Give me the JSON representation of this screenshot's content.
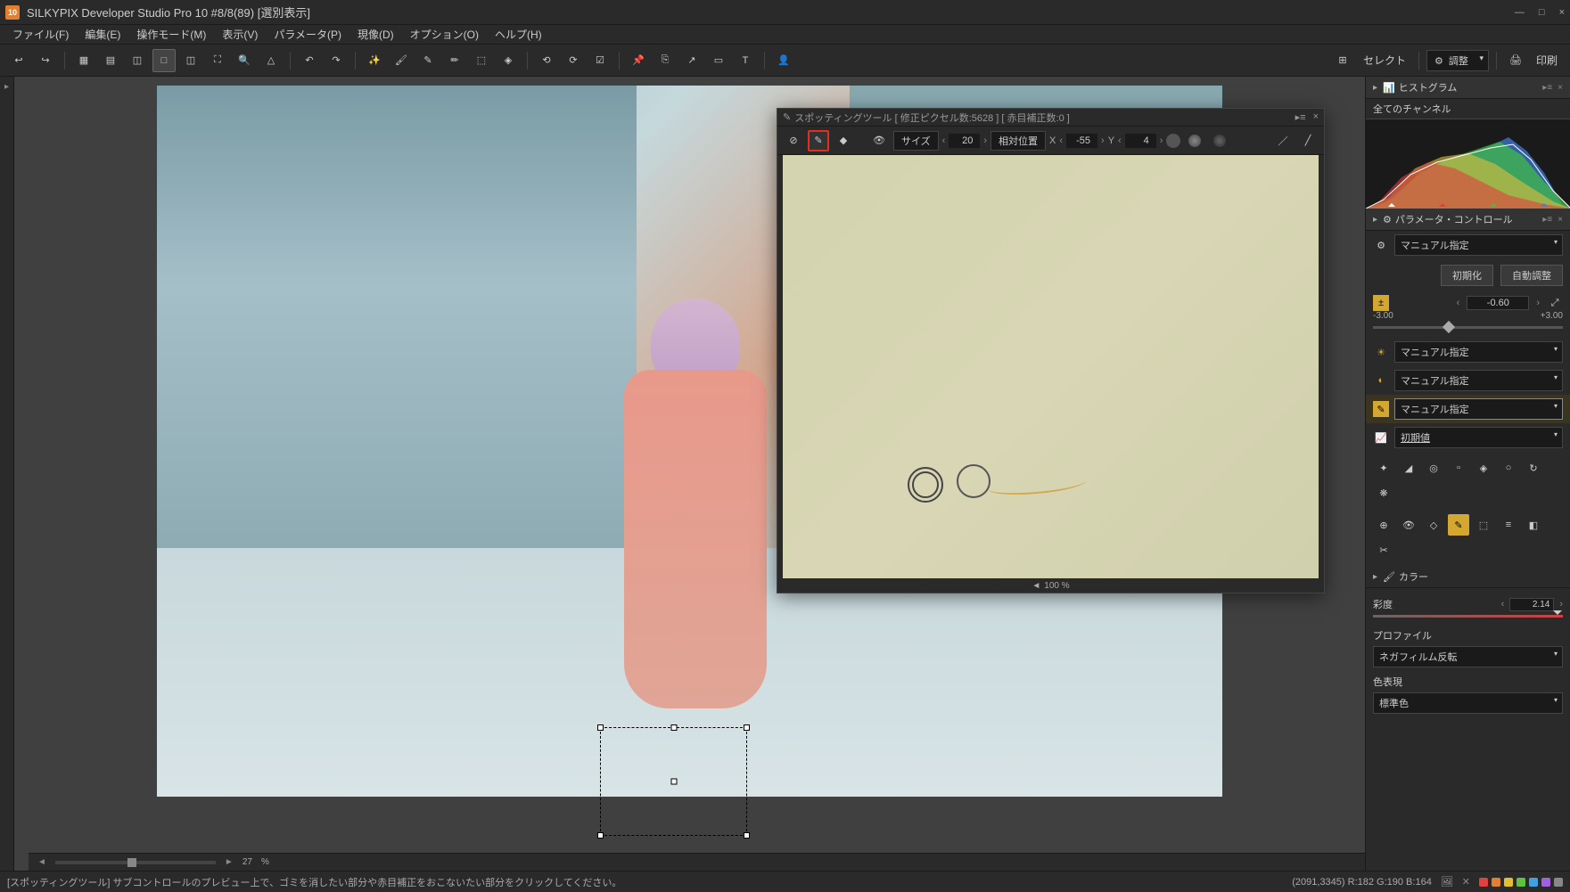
{
  "title": "SILKYPIX Developer Studio Pro 10    #8/8(89) [選別表示]",
  "menubar": [
    "ファイル(F)",
    "編集(E)",
    "操作モード(M)",
    "表示(V)",
    "パラメータ(P)",
    "現像(D)",
    "オプション(O)",
    "ヘルプ(H)"
  ],
  "toolbar_right": {
    "select": "セレクト",
    "adjust": "調整",
    "print": "印刷"
  },
  "canvas": {
    "zoom_percent": "27",
    "zoom_unit": "%"
  },
  "spotting": {
    "title": "スポッティングツール [ 修正ピクセル数:5628 ] [ 赤目補正数:0 ]",
    "size_label": "サイズ",
    "size_value": "20",
    "mode": "相対位置",
    "x_label": "X",
    "x_value": "-55",
    "y_label": "Y",
    "y_value": "4",
    "zoom": "100",
    "zoom_unit": "%"
  },
  "right": {
    "histogram_title": "ヒストグラム",
    "channel": "全てのチャンネル",
    "param_control_title": "パラメータ・コントロール",
    "mode_dd": "マニュアル指定",
    "init_btn": "初期化",
    "auto_btn": "自動調整",
    "exposure": {
      "value": "-0.60",
      "min": "-3.00",
      "max": "+3.00"
    },
    "rows": [
      {
        "label": "マニュアル指定"
      },
      {
        "label": "マニュアル指定"
      },
      {
        "label": "マニュアル指定"
      },
      {
        "label": "初期値",
        "underlined": true
      }
    ],
    "color_title": "カラー",
    "saturation_label": "彩度",
    "saturation_value": "2.14",
    "profile_label": "プロファイル",
    "profile_value": "ネガフィルム反転",
    "color_expr_label": "色表現",
    "color_expr_value": "標準色"
  },
  "status": {
    "left": "[スポッティングツール] サブコントロールのプレビュー上で、ゴミを消したい部分や赤目補正をおこないたい部分をクリックしてください。",
    "coords": "(2091,3345) R:182 G:190 B:164"
  }
}
